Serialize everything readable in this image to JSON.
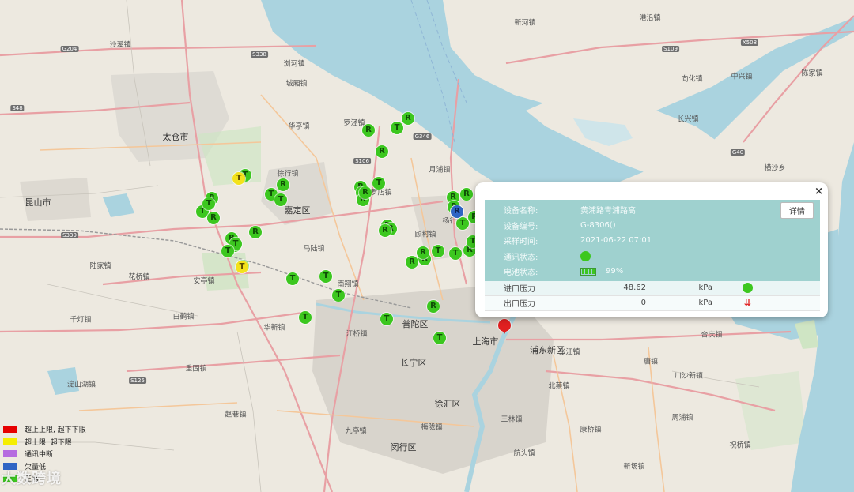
{
  "map": {
    "places": [
      {
        "text": "太仓市",
        "cls": "big"
      },
      {
        "text": "昆山市",
        "cls": "big"
      },
      {
        "text": "嘉定区",
        "cls": "big"
      },
      {
        "text": "宝山区",
        "cls": "big"
      },
      {
        "text": "普陀区",
        "cls": "big"
      },
      {
        "text": "长宁区",
        "cls": "big"
      },
      {
        "text": "上海市",
        "cls": "big"
      },
      {
        "text": "浦东新区",
        "cls": "big"
      },
      {
        "text": "徐汇区",
        "cls": "big"
      },
      {
        "text": "闵行区",
        "cls": "big"
      },
      {
        "text": "杨行镇",
        "cls": ""
      },
      {
        "text": "华亭镇",
        "cls": ""
      },
      {
        "text": "罗泾镇",
        "cls": ""
      },
      {
        "text": "徐行镇",
        "cls": ""
      },
      {
        "text": "月浦镇",
        "cls": ""
      },
      {
        "text": "罗店镇",
        "cls": ""
      },
      {
        "text": "顾村镇",
        "cls": ""
      },
      {
        "text": "马陆镇",
        "cls": ""
      },
      {
        "text": "南翔镇",
        "cls": ""
      },
      {
        "text": "安亭镇",
        "cls": ""
      },
      {
        "text": "华新镇",
        "cls": ""
      },
      {
        "text": "江桥镇",
        "cls": ""
      },
      {
        "text": "花桥镇",
        "cls": ""
      },
      {
        "text": "陆家镇",
        "cls": ""
      },
      {
        "text": "千灯镇",
        "cls": ""
      },
      {
        "text": "白鹤镇",
        "cls": ""
      },
      {
        "text": "重固镇",
        "cls": ""
      },
      {
        "text": "淀山湖镇",
        "cls": ""
      },
      {
        "text": "赵巷镇",
        "cls": ""
      },
      {
        "text": "九亭镇",
        "cls": ""
      },
      {
        "text": "梅陇镇",
        "cls": ""
      },
      {
        "text": "三林镇",
        "cls": ""
      },
      {
        "text": "康桥镇",
        "cls": ""
      },
      {
        "text": "北蔡镇",
        "cls": ""
      },
      {
        "text": "张江镇",
        "cls": ""
      },
      {
        "text": "唐镇",
        "cls": ""
      },
      {
        "text": "川沙新镇",
        "cls": ""
      },
      {
        "text": "曹路镇",
        "cls": ""
      },
      {
        "text": "合庆镇",
        "cls": ""
      },
      {
        "text": "祝桥镇",
        "cls": ""
      },
      {
        "text": "航头镇",
        "cls": ""
      },
      {
        "text": "新场镇",
        "cls": ""
      },
      {
        "text": "周浦镇",
        "cls": ""
      },
      {
        "text": "浏河镇",
        "cls": ""
      },
      {
        "text": "城厢镇",
        "cls": ""
      },
      {
        "text": "沙溪镇",
        "cls": ""
      },
      {
        "text": "新河镇",
        "cls": ""
      },
      {
        "text": "港沿镇",
        "cls": ""
      },
      {
        "text": "向化镇",
        "cls": ""
      },
      {
        "text": "中兴镇",
        "cls": ""
      },
      {
        "text": "陈家镇",
        "cls": ""
      },
      {
        "text": "长兴镇",
        "cls": ""
      },
      {
        "text": "横沙乡",
        "cls": ""
      },
      {
        "text": "G204",
        "cls": "road"
      },
      {
        "text": "S338",
        "cls": "road"
      },
      {
        "text": "S48",
        "cls": "road"
      },
      {
        "text": "S339",
        "cls": "road"
      },
      {
        "text": "S106",
        "cls": "road"
      },
      {
        "text": "G346",
        "cls": "road"
      },
      {
        "text": "S109",
        "cls": "road"
      },
      {
        "text": "X508",
        "cls": "road"
      },
      {
        "text": "G40",
        "cls": "road"
      },
      {
        "text": "S125",
        "cls": "road"
      }
    ],
    "markers": [
      {
        "label": "R",
        "color": "green"
      },
      {
        "label": "T",
        "color": "green"
      },
      {
        "label": "R",
        "color": "green"
      },
      {
        "label": "T",
        "color": "green"
      },
      {
        "label": "T",
        "color": "green"
      },
      {
        "label": "T",
        "color": "green"
      },
      {
        "label": "R",
        "color": "green"
      },
      {
        "label": "T",
        "color": "yellow"
      },
      {
        "label": "T",
        "color": "green"
      },
      {
        "label": "R",
        "color": "green"
      },
      {
        "label": "T",
        "color": "green"
      },
      {
        "label": "T",
        "color": "green"
      },
      {
        "label": "R",
        "color": "green"
      },
      {
        "label": "T",
        "color": "green"
      },
      {
        "label": "T",
        "color": "green"
      },
      {
        "label": "R",
        "color": "green"
      },
      {
        "label": "T",
        "color": "green"
      },
      {
        "label": "R",
        "color": "green"
      },
      {
        "label": "R",
        "color": "green"
      },
      {
        "label": "T",
        "color": "green"
      },
      {
        "label": "R",
        "color": "green"
      },
      {
        "label": "R",
        "color": "green"
      },
      {
        "label": "R",
        "color": "green"
      },
      {
        "label": "T",
        "color": "green"
      },
      {
        "label": "R",
        "color": "green"
      },
      {
        "label": "T",
        "color": "yellow"
      },
      {
        "label": "T",
        "color": "green"
      },
      {
        "label": "T",
        "color": "green"
      },
      {
        "label": "T",
        "color": "green"
      },
      {
        "label": "T",
        "color": "green"
      },
      {
        "label": "T",
        "color": "green"
      },
      {
        "label": "T",
        "color": "green"
      },
      {
        "label": "T",
        "color": "green"
      },
      {
        "label": "R",
        "color": "green"
      },
      {
        "label": "R",
        "color": "green"
      },
      {
        "label": "T",
        "color": "green"
      },
      {
        "label": "R",
        "color": "green"
      },
      {
        "label": "R",
        "color": "green"
      },
      {
        "label": "R",
        "color": "green"
      },
      {
        "label": "R",
        "color": "green"
      },
      {
        "label": "T",
        "color": "green"
      },
      {
        "label": "R",
        "color": "green"
      },
      {
        "label": "R",
        "color": "blue"
      },
      {
        "label": "R",
        "color": "green"
      },
      {
        "label": "R",
        "color": "green"
      },
      {
        "label": "R",
        "color": "green"
      },
      {
        "label": "R",
        "color": "green"
      },
      {
        "label": "T",
        "color": "green"
      },
      {
        "label": "R",
        "color": "green"
      },
      {
        "label": "",
        "color": "red"
      }
    ]
  },
  "popup": {
    "close": "×",
    "detail_button": "详情",
    "rows": {
      "name_key": "设备名称:",
      "name_val": "黄浦路青浦路高",
      "code_key": "设备编号:",
      "code_val": "G-8306()",
      "time_key": "采样时间:",
      "time_val": "2021-06-22 07:01",
      "comm_key": "通讯状态:",
      "batt_key": "电池状态:",
      "batt_val": "99%"
    },
    "pressure": [
      {
        "name": "进口压力",
        "value": "48.62",
        "unit": "kPa"
      },
      {
        "name": "出口压力",
        "value": "0",
        "unit": "kPa"
      }
    ],
    "status_color": "#3cc71f",
    "alarm_color": "#e02020"
  },
  "legend": [
    {
      "label": "超上上限, 超下下限",
      "color": "#e60000"
    },
    {
      "label": "超上限, 超下限",
      "color": "#f5ee00"
    },
    {
      "label": "通讯中断",
      "color": "#b56be0"
    },
    {
      "label": "欠量低",
      "color": "#2f64c4"
    },
    {
      "label": "正常",
      "color": "#3cc71f"
    }
  ],
  "watermark": "大数跨境"
}
